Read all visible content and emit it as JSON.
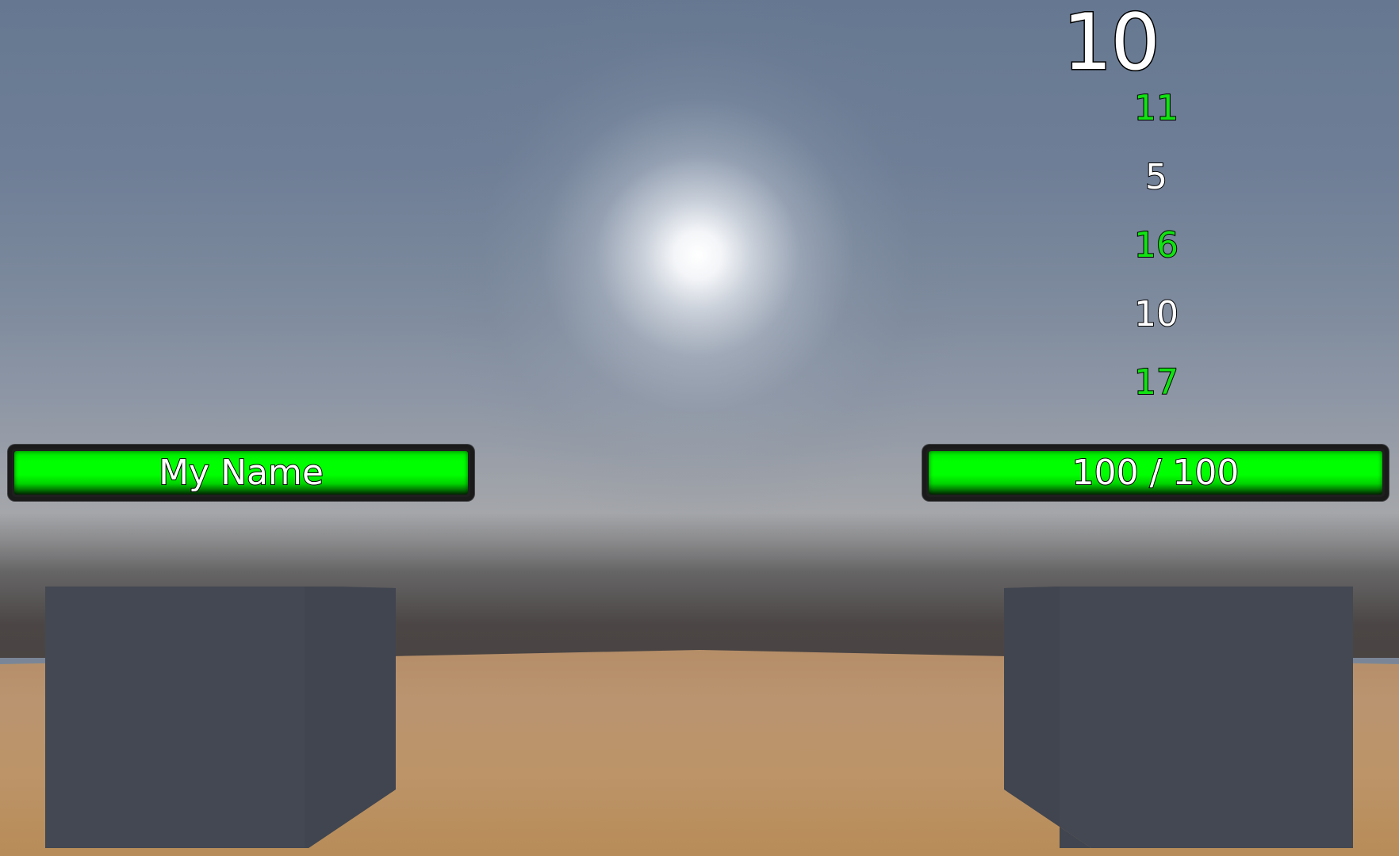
{
  "hud": {
    "score": "10",
    "rolls": [
      {
        "value": "11",
        "color": "#12e212"
      },
      {
        "value": "5",
        "color": "#ffffff"
      },
      {
        "value": "16",
        "color": "#12e212"
      },
      {
        "value": "10",
        "color": "#ffffff"
      },
      {
        "value": "17",
        "color": "#12e212"
      }
    ]
  },
  "player_bar": {
    "label": "My Name",
    "fill_fraction": 1.0,
    "color": "#00ff00"
  },
  "health_bar": {
    "label": "100 / 100",
    "current": 100,
    "max": 100,
    "fill_fraction": 1.0,
    "color": "#00ff00"
  },
  "colors": {
    "sky_top": "#667891",
    "ground": "#bc9468",
    "block": "#434852"
  }
}
